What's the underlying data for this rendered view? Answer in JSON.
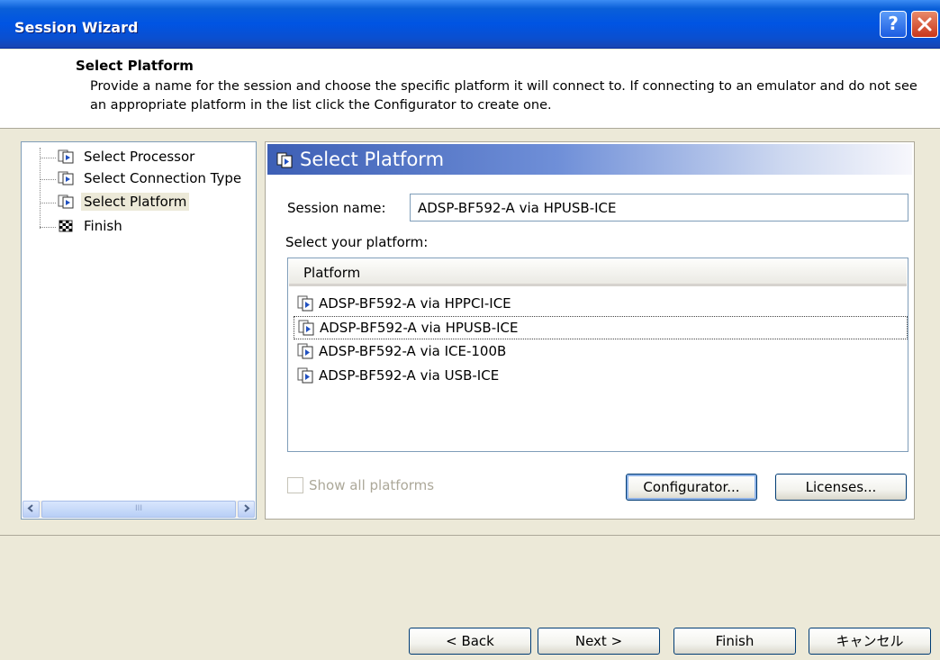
{
  "window": {
    "title": "Session Wizard"
  },
  "header": {
    "title": "Select Platform",
    "description": "Provide a name for the session and choose the specific platform it will connect to. If connecting to an emulator and do not see an appropriate platform in the list click the Configurator to create one."
  },
  "tree": {
    "items": [
      {
        "label": "Select Processor"
      },
      {
        "label": "Select Connection Type"
      },
      {
        "label": "Select Platform",
        "selected": true
      },
      {
        "label": "Finish"
      }
    ]
  },
  "panel": {
    "title": "Select Platform",
    "session_label": "Session name:",
    "session_value": "ADSP-BF592-A via HPUSB-ICE",
    "platform_label": "Select your platform:",
    "list_header": "Platform",
    "platforms": [
      "ADSP-BF592-A via HPPCI-ICE",
      "ADSP-BF592-A via HPUSB-ICE",
      "ADSP-BF592-A via ICE-100B",
      "ADSP-BF592-A via USB-ICE"
    ],
    "focused_index": 1,
    "show_all_label": "Show all platforms",
    "configurator_label": "Configurator...",
    "licenses_label": "Licenses..."
  },
  "footer": {
    "back_label": "< Back",
    "next_label": "Next >",
    "finish_label": "Finish",
    "cancel_label": "キャンセル"
  },
  "scrollbar": {
    "thumb_glyph": "III"
  },
  "colors": {
    "titlebar": "#0054e3",
    "panel_header": "#3d5fb5",
    "face": "#ece9d8"
  }
}
